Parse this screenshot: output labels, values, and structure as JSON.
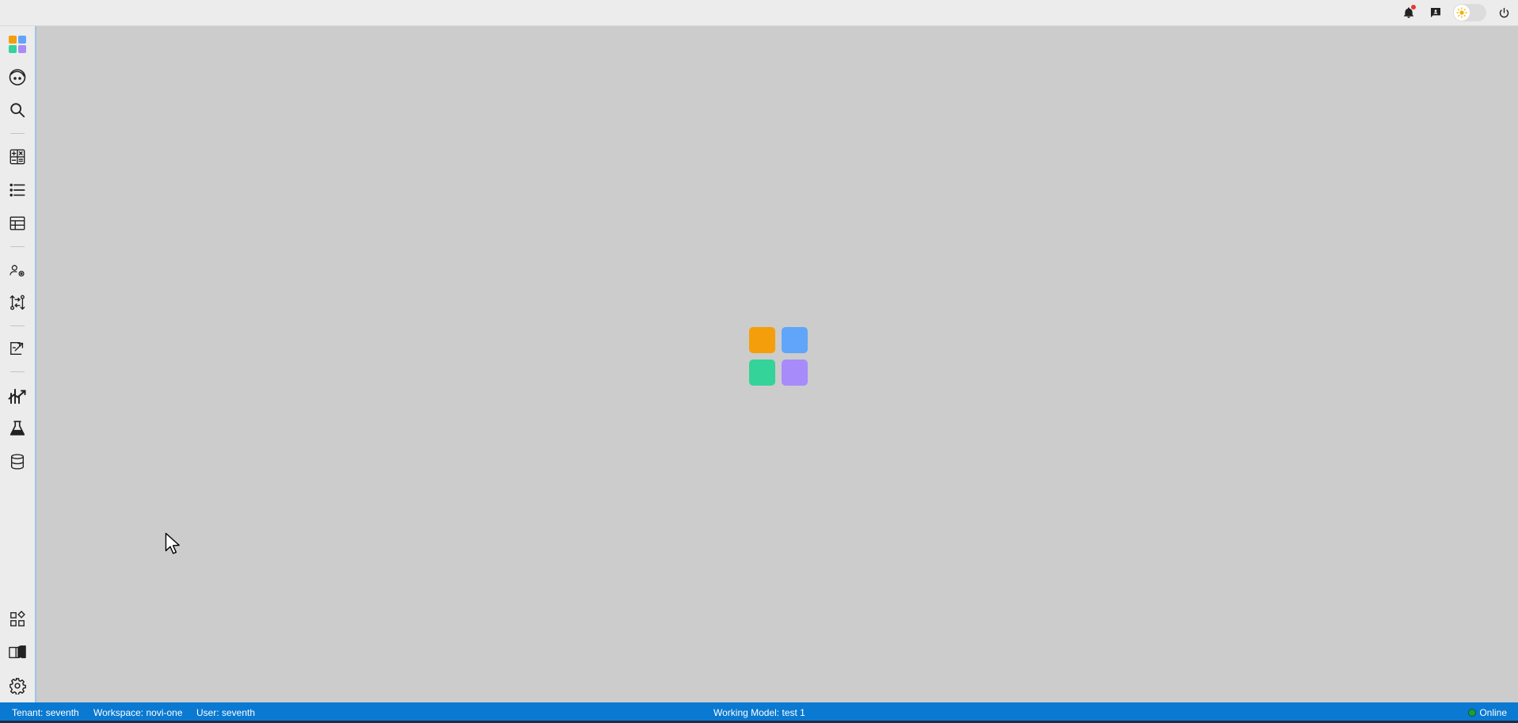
{
  "topbar": {
    "icons": [
      "bell-icon",
      "chat-icon",
      "sun-icon",
      "power-icon"
    ],
    "notification_color": "#e53935"
  },
  "sidebar": {
    "items": [
      {
        "icon": "app-grid-logo-icon"
      },
      {
        "icon": "face-icon"
      },
      {
        "icon": "search-icon"
      },
      {
        "icon": "calculator-icon"
      },
      {
        "icon": "list-icon"
      },
      {
        "icon": "table-icon"
      },
      {
        "icon": "user-settings-icon"
      },
      {
        "icon": "workflow-icon"
      },
      {
        "icon": "export-icon"
      },
      {
        "icon": "chart-icon"
      },
      {
        "icon": "flask-icon"
      },
      {
        "icon": "database-icon"
      },
      {
        "icon": "widgets-icon"
      },
      {
        "icon": "book-icon"
      },
      {
        "icon": "gear-icon"
      }
    ]
  },
  "loader": {
    "colors": [
      "#f59e0b",
      "#60a5fa",
      "#34d399",
      "#a78bfa"
    ]
  },
  "statusbar": {
    "tenant": "Tenant: seventh",
    "workspace": "Workspace: novi-one",
    "user": "User: seventh",
    "working_model": "Working Model: test 1",
    "status": "Online",
    "background": "#0a79d1"
  }
}
